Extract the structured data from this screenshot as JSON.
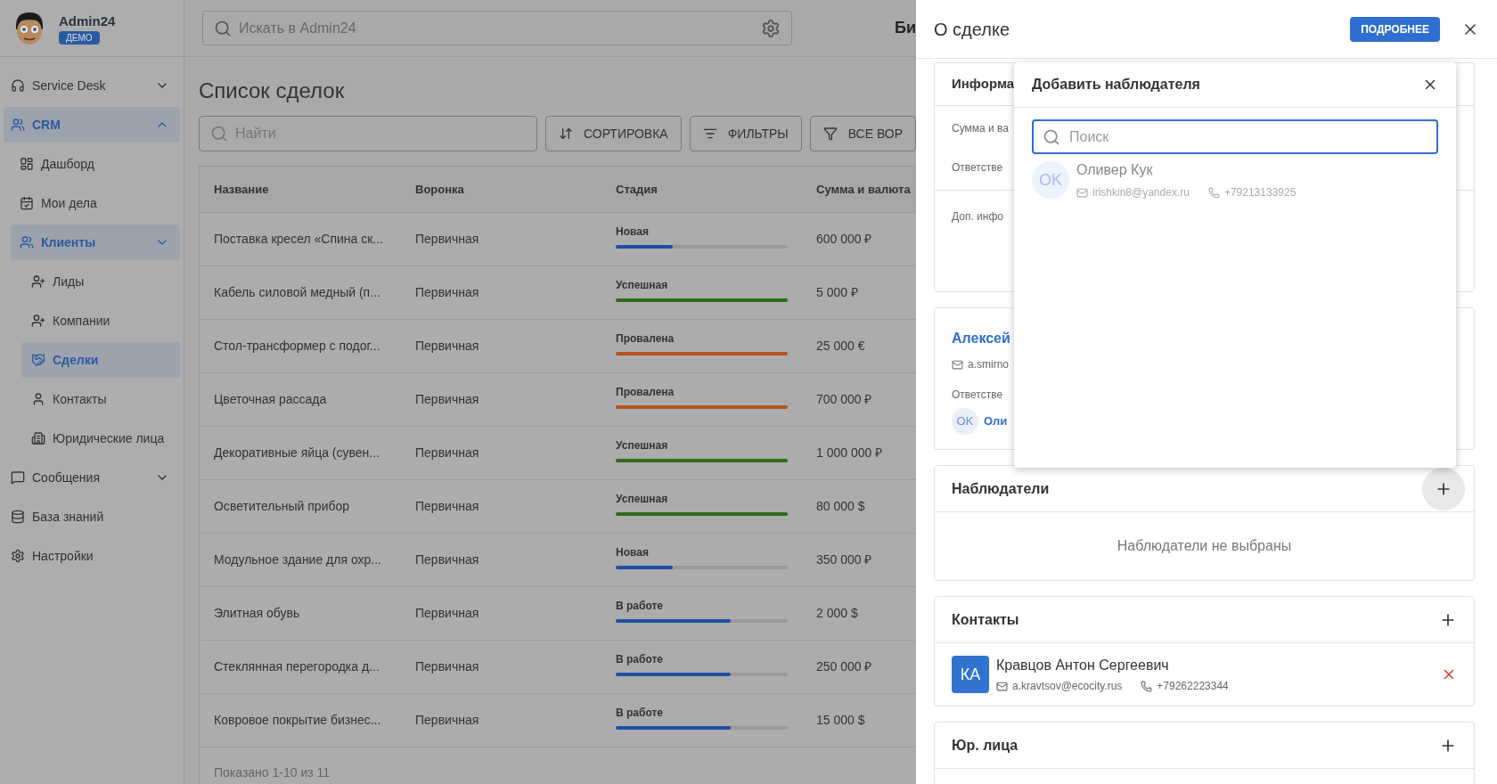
{
  "app": {
    "name": "Admin24",
    "badge": "ДЕМО"
  },
  "search": {
    "placeholder": "Искать в Admin24"
  },
  "header_cut_text": "Би",
  "sidebar": {
    "items": [
      {
        "label": "Service Desk",
        "selected": false,
        "expanded": false
      },
      {
        "label": "CRM",
        "selected": true,
        "expanded": true,
        "children": [
          {
            "label": "Дашборд",
            "selected": false
          },
          {
            "label": "Мои дела",
            "selected": false
          },
          {
            "label": "Клиенты",
            "selected": true,
            "expanded": false,
            "children": [
              {
                "label": "Лиды",
                "selected": false
              },
              {
                "label": "Компании",
                "selected": false
              },
              {
                "label": "Сделки",
                "selected": true
              },
              {
                "label": "Контакты",
                "selected": false
              },
              {
                "label": "Юридические лица",
                "selected": false
              }
            ]
          }
        ]
      },
      {
        "label": "Сообщения",
        "selected": false,
        "expanded": false
      },
      {
        "label": "База знаний",
        "selected": false
      },
      {
        "label": "Настройки",
        "selected": false
      }
    ]
  },
  "page": {
    "title": "Список сделок",
    "search_placeholder": "Найти",
    "buttons": [
      "СОРТИРОВКА",
      "ФИЛЬТРЫ",
      "ВСЕ ВОР"
    ]
  },
  "table": {
    "columns": [
      "Название",
      "Воронка",
      "Стадия",
      "Сумма и валюта"
    ],
    "rows": [
      {
        "name": "Поставка кресел «Спина ск...",
        "funnel": "Первичная",
        "stage": "Новая",
        "level": 0.33,
        "color": "#1e4fa8",
        "amount": "600 000 ₽"
      },
      {
        "name": "Кабель силовой медный (п...",
        "funnel": "Первичная",
        "stage": "Успешная",
        "level": 1,
        "color": "#2f6b1e",
        "amount": "5 000 ₽"
      },
      {
        "name": "Стол-трансформер с подог...",
        "funnel": "Первичная",
        "stage": "Провалена",
        "level": 1,
        "color": "#b5541d",
        "amount": "25 000 €"
      },
      {
        "name": "Цветочная рассада",
        "funnel": "Первичная",
        "stage": "Провалена",
        "level": 1,
        "color": "#b5541d",
        "amount": "700 000 ₽"
      },
      {
        "name": "Декоративные яйца (сувен...",
        "funnel": "Первичная",
        "stage": "Успешная",
        "level": 1,
        "color": "#2f6b1e",
        "amount": "1 000 000 ₽"
      },
      {
        "name": "Осветительный прибор",
        "funnel": "Первичная",
        "stage": "Успешная",
        "level": 1,
        "color": "#2f6b1e",
        "amount": "80 000 $"
      },
      {
        "name": "Модульное здание для охр...",
        "funnel": "Первичная",
        "stage": "Новая",
        "level": 0.33,
        "color": "#1e4fa8",
        "amount": "350 000 ₽"
      },
      {
        "name": "Элитная обувь",
        "funnel": "Первичная",
        "stage": "В работе",
        "level": 0.67,
        "color": "#1e4fa8",
        "amount": "2 000 $"
      },
      {
        "name": "Стеклянная перегородка д...",
        "funnel": "Первичная",
        "stage": "В работе",
        "level": 0.67,
        "color": "#1e4fa8",
        "amount": "250 000 ₽"
      },
      {
        "name": "Ковровое покрытие бизнес...",
        "funnel": "Первичная",
        "stage": "В работе",
        "level": 0.67,
        "color": "#1e4fa8",
        "amount": "15 000 $"
      }
    ],
    "footer": "Показано 1-10 из 11"
  },
  "drawer": {
    "title": "О сделке",
    "button": "ПОДРОБНЕЕ",
    "info_card": {
      "title": "Информа",
      "fields": [
        "Сумма и ва",
        "Ответстве"
      ],
      "extra": "Доп. инфо"
    },
    "client_card": {
      "name": "Алексей",
      "email": "a.smirno",
      "label": "Ответстве",
      "avatar": "OK",
      "person": "Оли"
    },
    "observers": {
      "title": "Наблюдатели",
      "empty": "Наблюдатели не выбраны"
    },
    "contacts": {
      "title": "Контакты",
      "items": [
        {
          "avatar": "КА",
          "name": "Кравцов Антон Сергеевич",
          "email": "a.kravtsov@ecocity.rus",
          "phone": "+79262223344"
        }
      ]
    },
    "legal": {
      "title": "Юр. лица"
    }
  },
  "dialog": {
    "title": "Добавить наблюдателя",
    "placeholder": "Поиск",
    "results": [
      {
        "avatar": "OK",
        "name": "Оливер Кук",
        "email": "irishkin8@yandex.ru",
        "phone": "+79213133925"
      }
    ]
  }
}
